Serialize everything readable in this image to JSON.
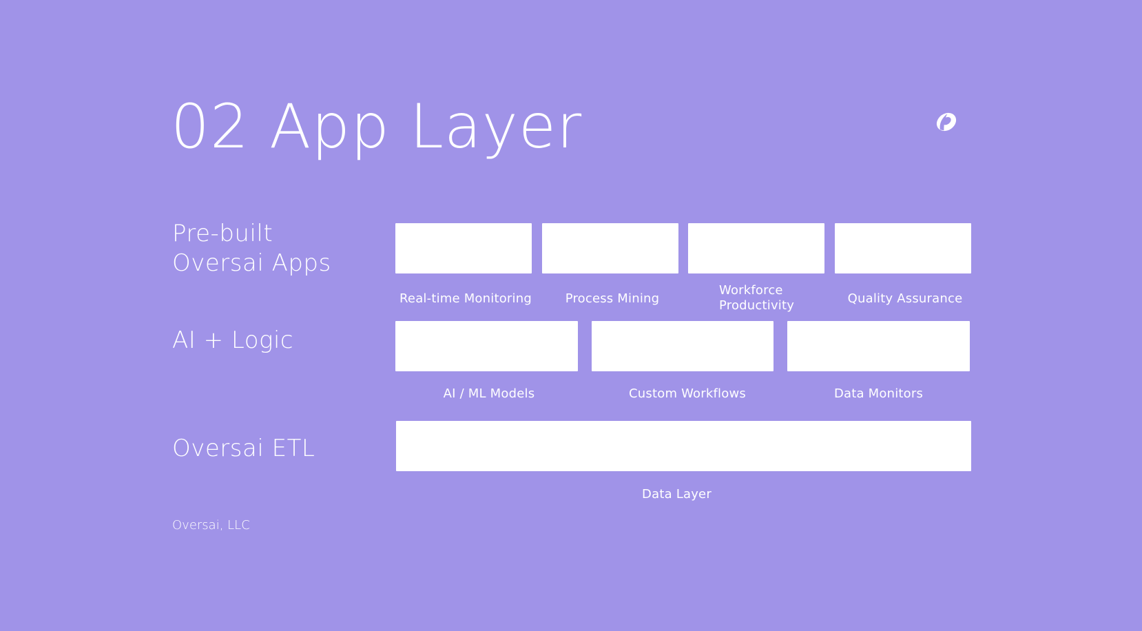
{
  "slide": {
    "title": "02 App Layer",
    "logo_icon": "oversai-logo-icon",
    "background_color": "#a093e8",
    "footer": "Oversai, LLC"
  },
  "layers": [
    {
      "label_lines": [
        "Pre-built",
        "Oversai Apps"
      ],
      "items": [
        {
          "label_lines": [
            "Real-time Monitoring"
          ]
        },
        {
          "label_lines": [
            "Process Mining"
          ]
        },
        {
          "label_lines": [
            "Workforce",
            "Productivity"
          ]
        },
        {
          "label_lines": [
            "Quality Assurance"
          ]
        }
      ]
    },
    {
      "label_lines": [
        "AI + Logic"
      ],
      "items": [
        {
          "label_lines": [
            "AI / ML Models"
          ]
        },
        {
          "label_lines": [
            "Custom Workflows"
          ]
        },
        {
          "label_lines": [
            "Data Monitors"
          ]
        }
      ]
    },
    {
      "label_lines": [
        "Oversai ETL"
      ],
      "items": [
        {
          "label_lines": [
            "Data Layer"
          ]
        }
      ]
    }
  ]
}
